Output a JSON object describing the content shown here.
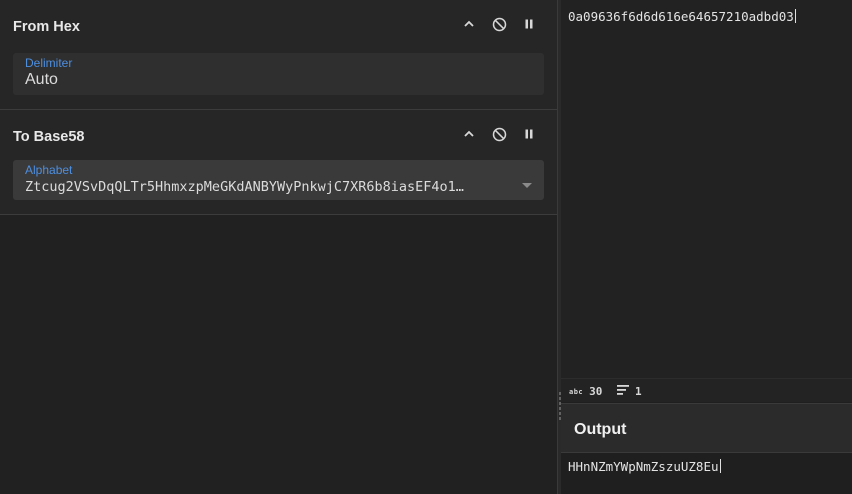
{
  "recipe": {
    "operations": [
      {
        "title": "From Hex",
        "field_label": "Delimiter",
        "field_value": "Auto"
      },
      {
        "title": "To Base58",
        "field_label": "Alphabet",
        "field_value": "Ztcug2VSvDqQLTr5HhmxzpMeGKdANBYWyPnkwjC7XR6b8iasEF4o1…"
      }
    ]
  },
  "input": {
    "text": "0a09636f6d6d616e64657210adbd03"
  },
  "status": {
    "length_icon": "abc",
    "length": "30",
    "lines": "1"
  },
  "output": {
    "title": "Output",
    "text": "HHnNZmYWpNmZszuUZ8Eu"
  },
  "icons": [
    "chevron-up-icon",
    "disable-icon",
    "pause-icon",
    "dropdown-arrow-icon",
    "lines-icon"
  ]
}
